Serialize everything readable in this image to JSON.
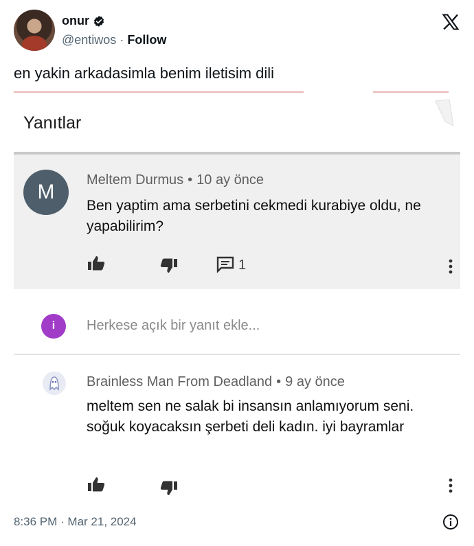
{
  "tweet": {
    "user_name": "onur",
    "handle": "@entiwos",
    "separator": "·",
    "follow_label": "Follow",
    "text": "en yakin arkadasimla benim iletisim dili",
    "timestamp": "8:36 PM · Mar 21, 2024"
  },
  "screenshot": {
    "section_title": "Yanıtlar",
    "comments": [
      {
        "avatar_letter": "M",
        "author": "Meltem Durmus",
        "dot": "•",
        "time": "10 ay önce",
        "text": "Ben yaptim ama serbetini cekmedi kurabiye oldu, ne yapabilirim?",
        "reply_count": "1"
      },
      {
        "author": "Brainless Man From Deadland",
        "dot": "•",
        "time": "9 ay önce",
        "text": "meltem sen ne salak bi insansın anlamıyorum seni. soğuk koyacaksın şerbeti deli kadın. iyi bayramlar"
      }
    ],
    "reply_box": {
      "avatar_letter": "i",
      "placeholder": "Herkese açık bir yanıt ekle..."
    }
  },
  "colors": {
    "verified": "#0f1419",
    "reply_avatar": "#a13cc8",
    "comment_avatar": "#4e5f6b"
  },
  "icons": [
    "verified-icon",
    "x-logo-icon",
    "thumbs-up-icon",
    "thumbs-down-icon",
    "comment-icon",
    "more-vert-icon",
    "info-icon"
  ]
}
